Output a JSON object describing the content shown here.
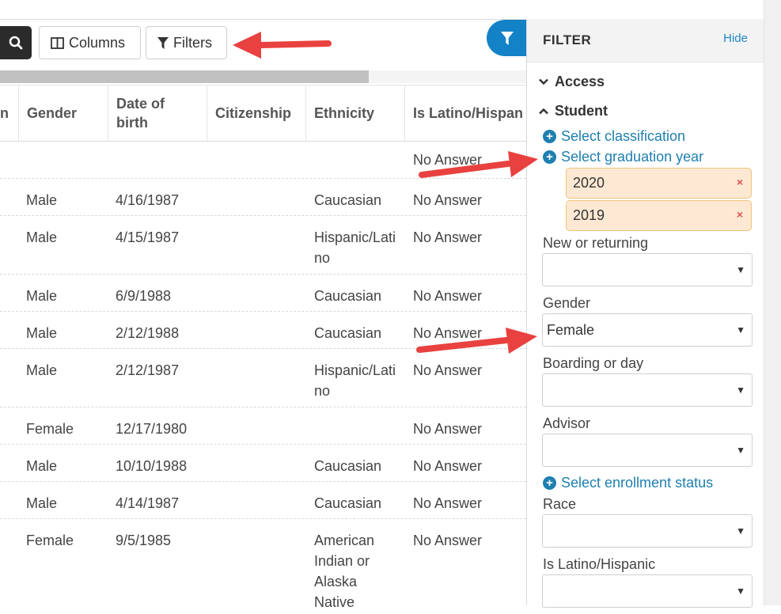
{
  "toolbar": {
    "columns_label": "Columns",
    "filters_label": "Filters"
  },
  "table": {
    "headers": [
      "n",
      "Gender",
      "Date of birth",
      "Citizenship",
      "Ethnicity",
      "Is Latino/Hispan"
    ],
    "rows": [
      {
        "gender": "",
        "dob": "",
        "citizenship": "",
        "ethnicity": "",
        "latino": "No Answer"
      },
      {
        "gender": "Male",
        "dob": "4/16/1987",
        "citizenship": "",
        "ethnicity": "Caucasian",
        "latino": "No Answer"
      },
      {
        "gender": "Male",
        "dob": "4/15/1987",
        "citizenship": "",
        "ethnicity": "Hispanic/Latino",
        "latino": "No Answer"
      },
      {
        "gender": "Male",
        "dob": "6/9/1988",
        "citizenship": "",
        "ethnicity": "Caucasian",
        "latino": "No Answer"
      },
      {
        "gender": "Male",
        "dob": "2/12/1988",
        "citizenship": "",
        "ethnicity": "Caucasian",
        "latino": "No Answer"
      },
      {
        "gender": "Male",
        "dob": "2/12/1987",
        "citizenship": "",
        "ethnicity": "Hispanic/Latino",
        "latino": "No Answer"
      },
      {
        "gender": "Female",
        "dob": "12/17/1980",
        "citizenship": "",
        "ethnicity": "",
        "latino": "No Answer"
      },
      {
        "gender": "Male",
        "dob": "10/10/1988",
        "citizenship": "",
        "ethnicity": "Caucasian",
        "latino": "No Answer"
      },
      {
        "gender": "Male",
        "dob": "4/14/1987",
        "citizenship": "",
        "ethnicity": "Caucasian",
        "latino": "No Answer"
      },
      {
        "gender": "Female",
        "dob": "9/5/1985",
        "citizenship": "",
        "ethnicity": "American Indian or Alaska Native",
        "latino": "No Answer"
      }
    ]
  },
  "filter": {
    "title": "FILTER",
    "hide_label": "Hide",
    "section_access": "Access",
    "section_student": "Student",
    "select_classification": "Select classification",
    "select_graduation_year": "Select graduation year",
    "graduation_years": [
      "2020",
      "2019"
    ],
    "chip_remove": "×",
    "new_or_returning_label": "New or returning",
    "new_or_returning_value": "",
    "gender_label": "Gender",
    "gender_value": "Female",
    "boarding_label": "Boarding or day",
    "boarding_value": "",
    "advisor_label": "Advisor",
    "advisor_value": "",
    "select_enrollment_status": "Select enrollment status",
    "race_label": "Race",
    "race_value": "",
    "latino_label": "Is Latino/Hispanic",
    "latino_value": ""
  },
  "colors": {
    "accent": "#1482c6",
    "link": "#1e7fb0",
    "chip_bg": "#fde9d3",
    "arrow": "#e8413f"
  }
}
